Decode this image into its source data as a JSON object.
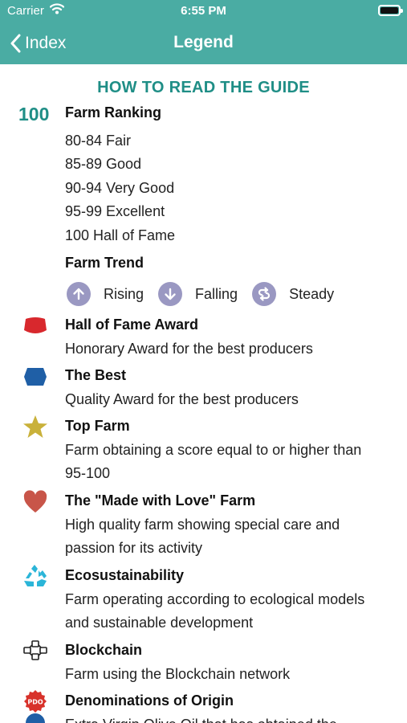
{
  "status": {
    "carrier": "Carrier",
    "time": "6:55 PM"
  },
  "nav": {
    "back_label": "Index",
    "title": "Legend"
  },
  "guide": {
    "heading": "HOW TO READ THE GUIDE",
    "ranking": {
      "number": "100",
      "title": "Farm Ranking",
      "levels": [
        "80-84 Fair",
        "85-89 Good",
        "90-94 Very Good",
        "95-99 Excellent",
        "100 Hall of Fame"
      ]
    },
    "trend": {
      "title": "Farm Trend",
      "items": [
        {
          "label": "Rising",
          "icon": "arrow-up-icon"
        },
        {
          "label": "Falling",
          "icon": "arrow-down-icon"
        },
        {
          "label": "Steady",
          "icon": "swap-arrows-icon"
        }
      ]
    },
    "entries": [
      {
        "icon": "red-badge-icon",
        "color": "#d8282d",
        "title": "Hall of Fame Award",
        "lines": [
          "Honorary Award for the best producers"
        ]
      },
      {
        "icon": "blue-badge-icon",
        "color": "#1f5fa6",
        "title": "The Best",
        "lines": [
          "Quality Award for the best producers"
        ]
      },
      {
        "icon": "star-icon",
        "color": "#c9b13a",
        "title": "Top Farm",
        "lines": [
          "Farm obtaining a score equal to or higher than",
          "95-100"
        ]
      },
      {
        "icon": "heart-icon",
        "color": "#c85549",
        "title": "The \"Made with Love\" Farm",
        "lines": [
          "High quality farm showing special care and",
          "passion for its activity"
        ]
      },
      {
        "icon": "recycle-icon",
        "color": "#2bb5d8",
        "title": "Ecosustainability",
        "lines": [
          "Farm operating according to ecological models",
          "and sustainable development"
        ]
      },
      {
        "icon": "blockchain-icon",
        "color": "#222222",
        "title": "Blockchain",
        "lines": [
          "Farm using the Blockchain network"
        ]
      },
      {
        "icon": "pdo-seal-icon",
        "color": "#d8322b",
        "seal_text": "PDO",
        "title": "Denominations of Origin",
        "lines": [
          "Extra Virgin Olive Oil that has obtained the"
        ]
      }
    ]
  },
  "colors": {
    "accent": "#4aaca3",
    "heading": "#1f8e86",
    "trend_circle": "#9a98c2"
  }
}
